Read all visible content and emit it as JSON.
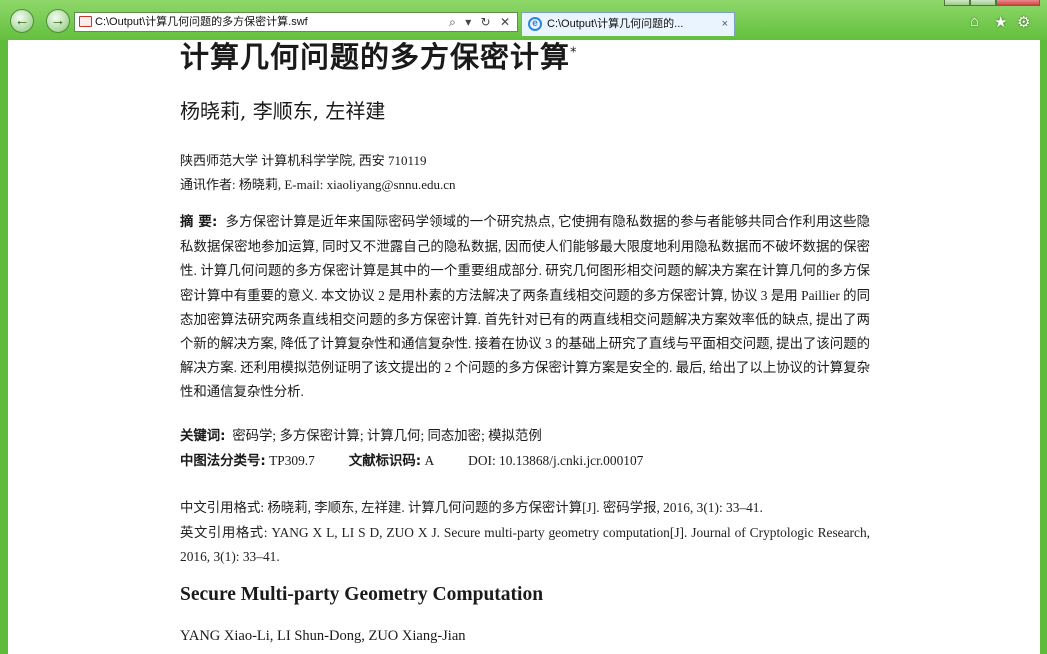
{
  "browser": {
    "address_url": "C:\\Output\\计算几何问题的多方保密计算.swf",
    "address_controls": "⌕ ▾ ↻ ✕",
    "tab_title": "C:\\Output\\计算几何问题的...",
    "tab_close": "×",
    "back_glyph": "←",
    "forward_glyph": "→",
    "home_glyph": "⌂",
    "favorites_glyph": "★",
    "tools_glyph": "⚙",
    "accent_color": "#63bf3e"
  },
  "paper": {
    "title": "计算几何问题的多方保密计算",
    "title_mark": "*",
    "authors": "杨晓莉, 李顺东, 左祥建",
    "affiliation": "陕西师范大学  计算机科学学院, 西安  710119",
    "corresponding": "通讯作者: 杨晓莉, E-mail: xiaoliyang@snnu.edu.cn",
    "abstract_label": "摘    要:",
    "abstract_text": "多方保密计算是近年来国际密码学领域的一个研究热点, 它使拥有隐私数据的参与者能够共同合作利用这些隐私数据保密地参加运算, 同时又不泄露自己的隐私数据, 因而使人们能够最大限度地利用隐私数据而不破坏数据的保密性. 计算几何问题的多方保密计算是其中的一个重要组成部分. 研究几何图形相交问题的解决方案在计算几何的多方保密计算中有重要的意义. 本文协议 2 是用朴素的方法解决了两条直线相交问题的多方保密计算, 协议 3 是用 Paillier 的同态加密算法研究两条直线相交问题的多方保密计算. 首先针对已有的两直线相交问题解决方案效率低的缺点, 提出了两个新的解决方案, 降低了计算复杂性和通信复杂性. 接着在协议 3 的基础上研究了直线与平面相交问题, 提出了该问题的解决方案. 还利用模拟范例证明了该文提出的 2 个问题的多方保密计算方案是安全的. 最后, 给出了以上协议的计算复杂性和通信复杂性分析.",
    "keywords_label": "关键词:",
    "keywords_text": "密码学; 多方保密计算; 计算几何; 同态加密; 模拟范例",
    "clc_label": "中图法分类号:",
    "clc_value": "TP309.7",
    "doc_code_label": "文献标识码:",
    "doc_code_value": "A",
    "doi": "DOI: 10.13868/j.cnki.jcr.000107",
    "cite_cn": "中文引用格式: 杨晓莉, 李顺东, 左祥建. 计算几何问题的多方保密计算[J]. 密码学报, 2016, 3(1): 33–41.",
    "cite_en": "英文引用格式: YANG X L, LI S D, ZUO X J. Secure multi-party geometry computation[J]. Journal of Cryptologic Research, 2016, 3(1): 33–41.",
    "en_title": "Secure Multi-party Geometry Computation",
    "en_authors": "YANG Xiao-Li, LI Shun-Dong, ZUO Xiang-Jian"
  }
}
